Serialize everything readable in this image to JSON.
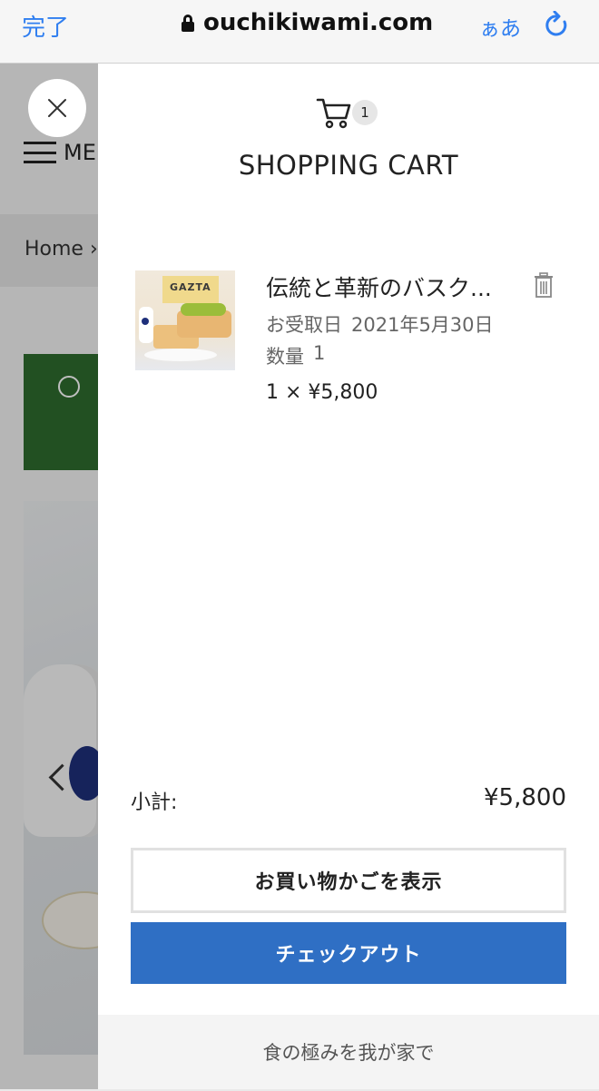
{
  "browser": {
    "done_label": "完了",
    "url": "ouchikiwami.com",
    "text_size_label": "ぁあ"
  },
  "background_page": {
    "menu_label": "ME",
    "breadcrumb": "Home ›"
  },
  "cart": {
    "title": "SHOPPING CART",
    "count": "1",
    "items": [
      {
        "name": "伝統と革新のバスク...",
        "pickup_label": "お受取日",
        "pickup_date": "2021年5月30日",
        "quantity_label": "数量",
        "quantity": "1",
        "price_line": "1 × ¥5,800",
        "image_brand": "GAZTA"
      }
    ],
    "subtotal_label": "小計:",
    "subtotal_value": "¥5,800",
    "view_cart_label": "お買い物かごを表示",
    "checkout_label": "チェックアウト",
    "footer_text": "食の極みを我が家で"
  },
  "colors": {
    "link_blue": "#2f7ef0",
    "checkout_blue": "#2f6fc4",
    "banner_green": "#2e6b2e"
  }
}
